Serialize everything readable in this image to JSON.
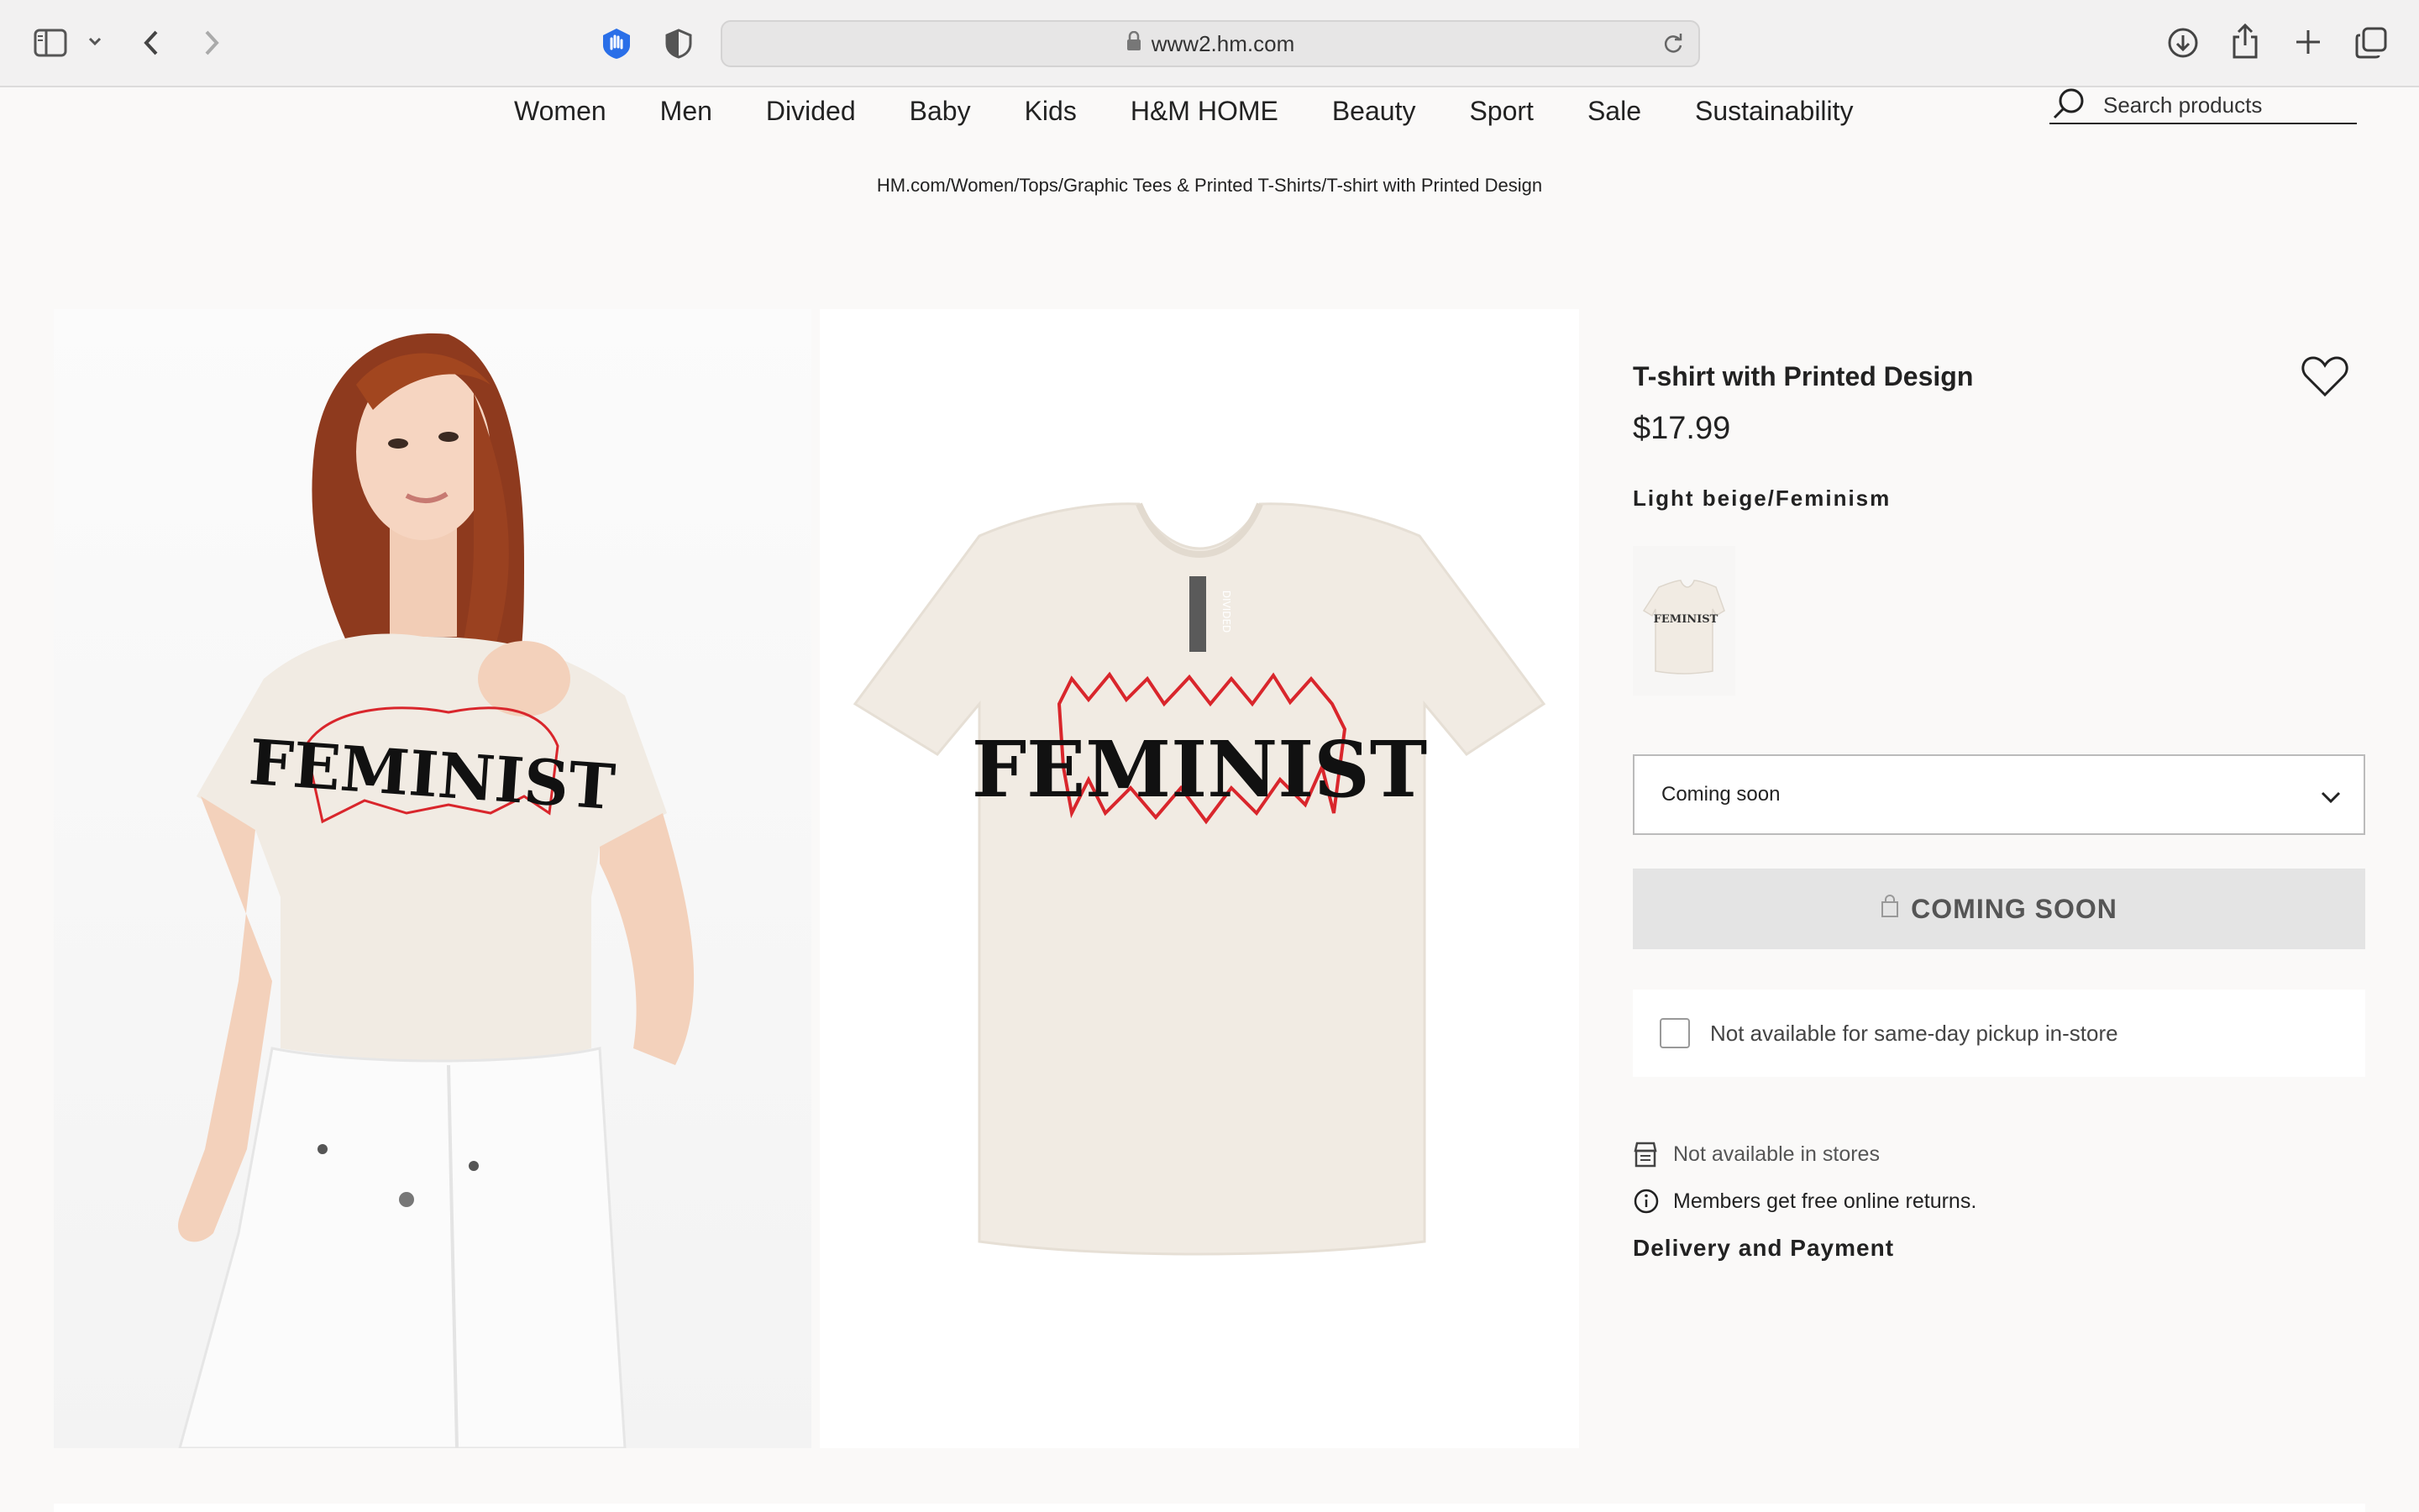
{
  "browser": {
    "url": "www2.hm.com",
    "icons": [
      "sidebar-icon",
      "chevron-down-icon",
      "back-icon",
      "forward-icon",
      "privacy-hand-icon",
      "shield-icon",
      "lock-icon",
      "reload-icon",
      "download-icon",
      "share-icon",
      "new-tab-icon",
      "tabs-overview-icon"
    ]
  },
  "nav": {
    "links": [
      "Women",
      "Men",
      "Divided",
      "Baby",
      "Kids",
      "H&M HOME",
      "Beauty",
      "Sport",
      "Sale",
      "Sustainability"
    ],
    "search_placeholder": "Search products"
  },
  "breadcrumb": "HM.com/Women/Tops/Graphic Tees & Printed T-Shirts/T-shirt with Printed Design",
  "product": {
    "title": "T-shirt with Printed Design",
    "price": "$17.99",
    "color": "Light beige/Feminism",
    "print_text": "FEMINIST",
    "brand_label": "DIVIDED",
    "size_select": "Coming soon",
    "cta": "COMING SOON",
    "pickup": "Not available for same-day pickup in-store",
    "stores": "Not available in stores",
    "returns": "Members get free online returns.",
    "delivery": "Delivery and Payment"
  },
  "colors": {
    "accent_red": "#d9262c",
    "shirt": "#f1ebe3",
    "cta_bg": "#e4e4e4"
  }
}
